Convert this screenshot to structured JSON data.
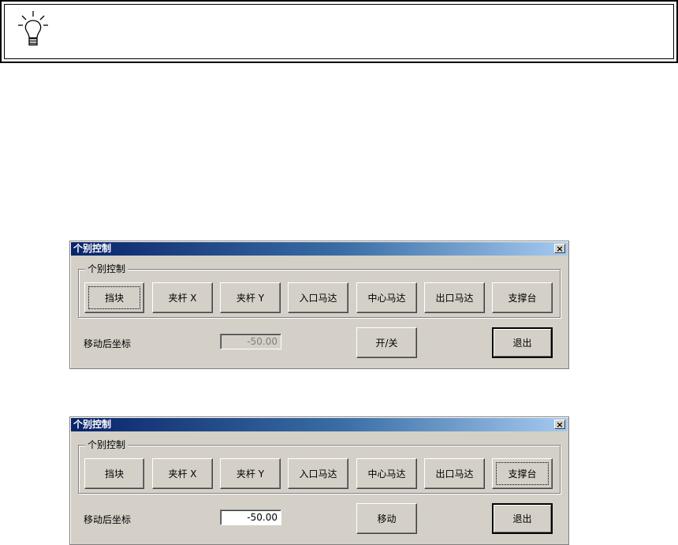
{
  "dialogs": [
    {
      "title": "个别控制",
      "close_label": "×",
      "group_label": "个别控制",
      "buttons": [
        "挡块",
        "夹杆 X",
        "夹杆 Y",
        "入口马达",
        "中心马达",
        "出口马达",
        "支撑台"
      ],
      "coord_label": "移动后坐标",
      "coord_value": "-50.00",
      "action_label": "开/关",
      "exit_label": "退出"
    },
    {
      "title": "个别控制",
      "close_label": "×",
      "group_label": "个别控制",
      "buttons": [
        "挡块",
        "夹杆 X",
        "夹杆 Y",
        "入口马达",
        "中心马达",
        "出口马达",
        "支撑台"
      ],
      "coord_label": "移动后坐标",
      "coord_value": "-50.00",
      "action_label": "移动",
      "exit_label": "退出"
    }
  ]
}
